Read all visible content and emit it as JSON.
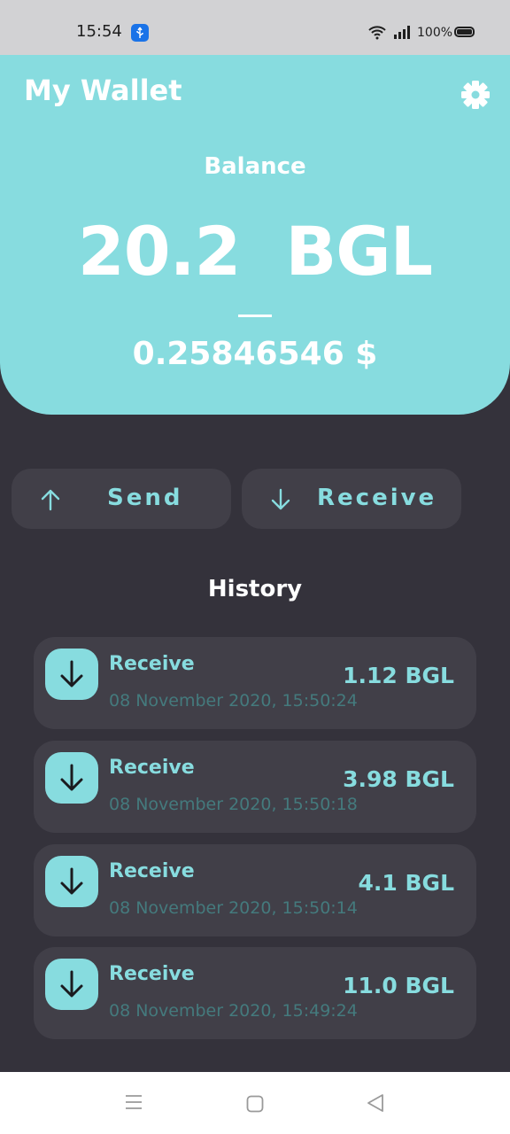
{
  "status_bar": {
    "time": "15:54",
    "battery": "100%"
  },
  "header": {
    "title": "My Wallet",
    "balance_label": "Balance",
    "balance_amount": "20.2  BGL",
    "balance_usd": "0.25846546 $"
  },
  "actions": {
    "send_label": "Send",
    "receive_label": "Receive"
  },
  "history": {
    "title": "History",
    "items": [
      {
        "type": "Receive",
        "amount": "1.12 BGL",
        "date": "08 November 2020, 15:50:24"
      },
      {
        "type": "Receive",
        "amount": "3.98 BGL",
        "date": "08 November 2020, 15:50:18"
      },
      {
        "type": "Receive",
        "amount": "4.1 BGL",
        "date": "08 November 2020, 15:50:14"
      },
      {
        "type": "Receive",
        "amount": "11.0 BGL",
        "date": "08 November 2020, 15:49:24"
      }
    ]
  },
  "colors": {
    "accent": "#87dcdf",
    "background": "#34323b",
    "card": "#413f48",
    "date_text": "#447a7d"
  },
  "icons": {
    "settings": "gear-icon",
    "send": "arrow-up-icon",
    "receive": "arrow-down-icon"
  }
}
